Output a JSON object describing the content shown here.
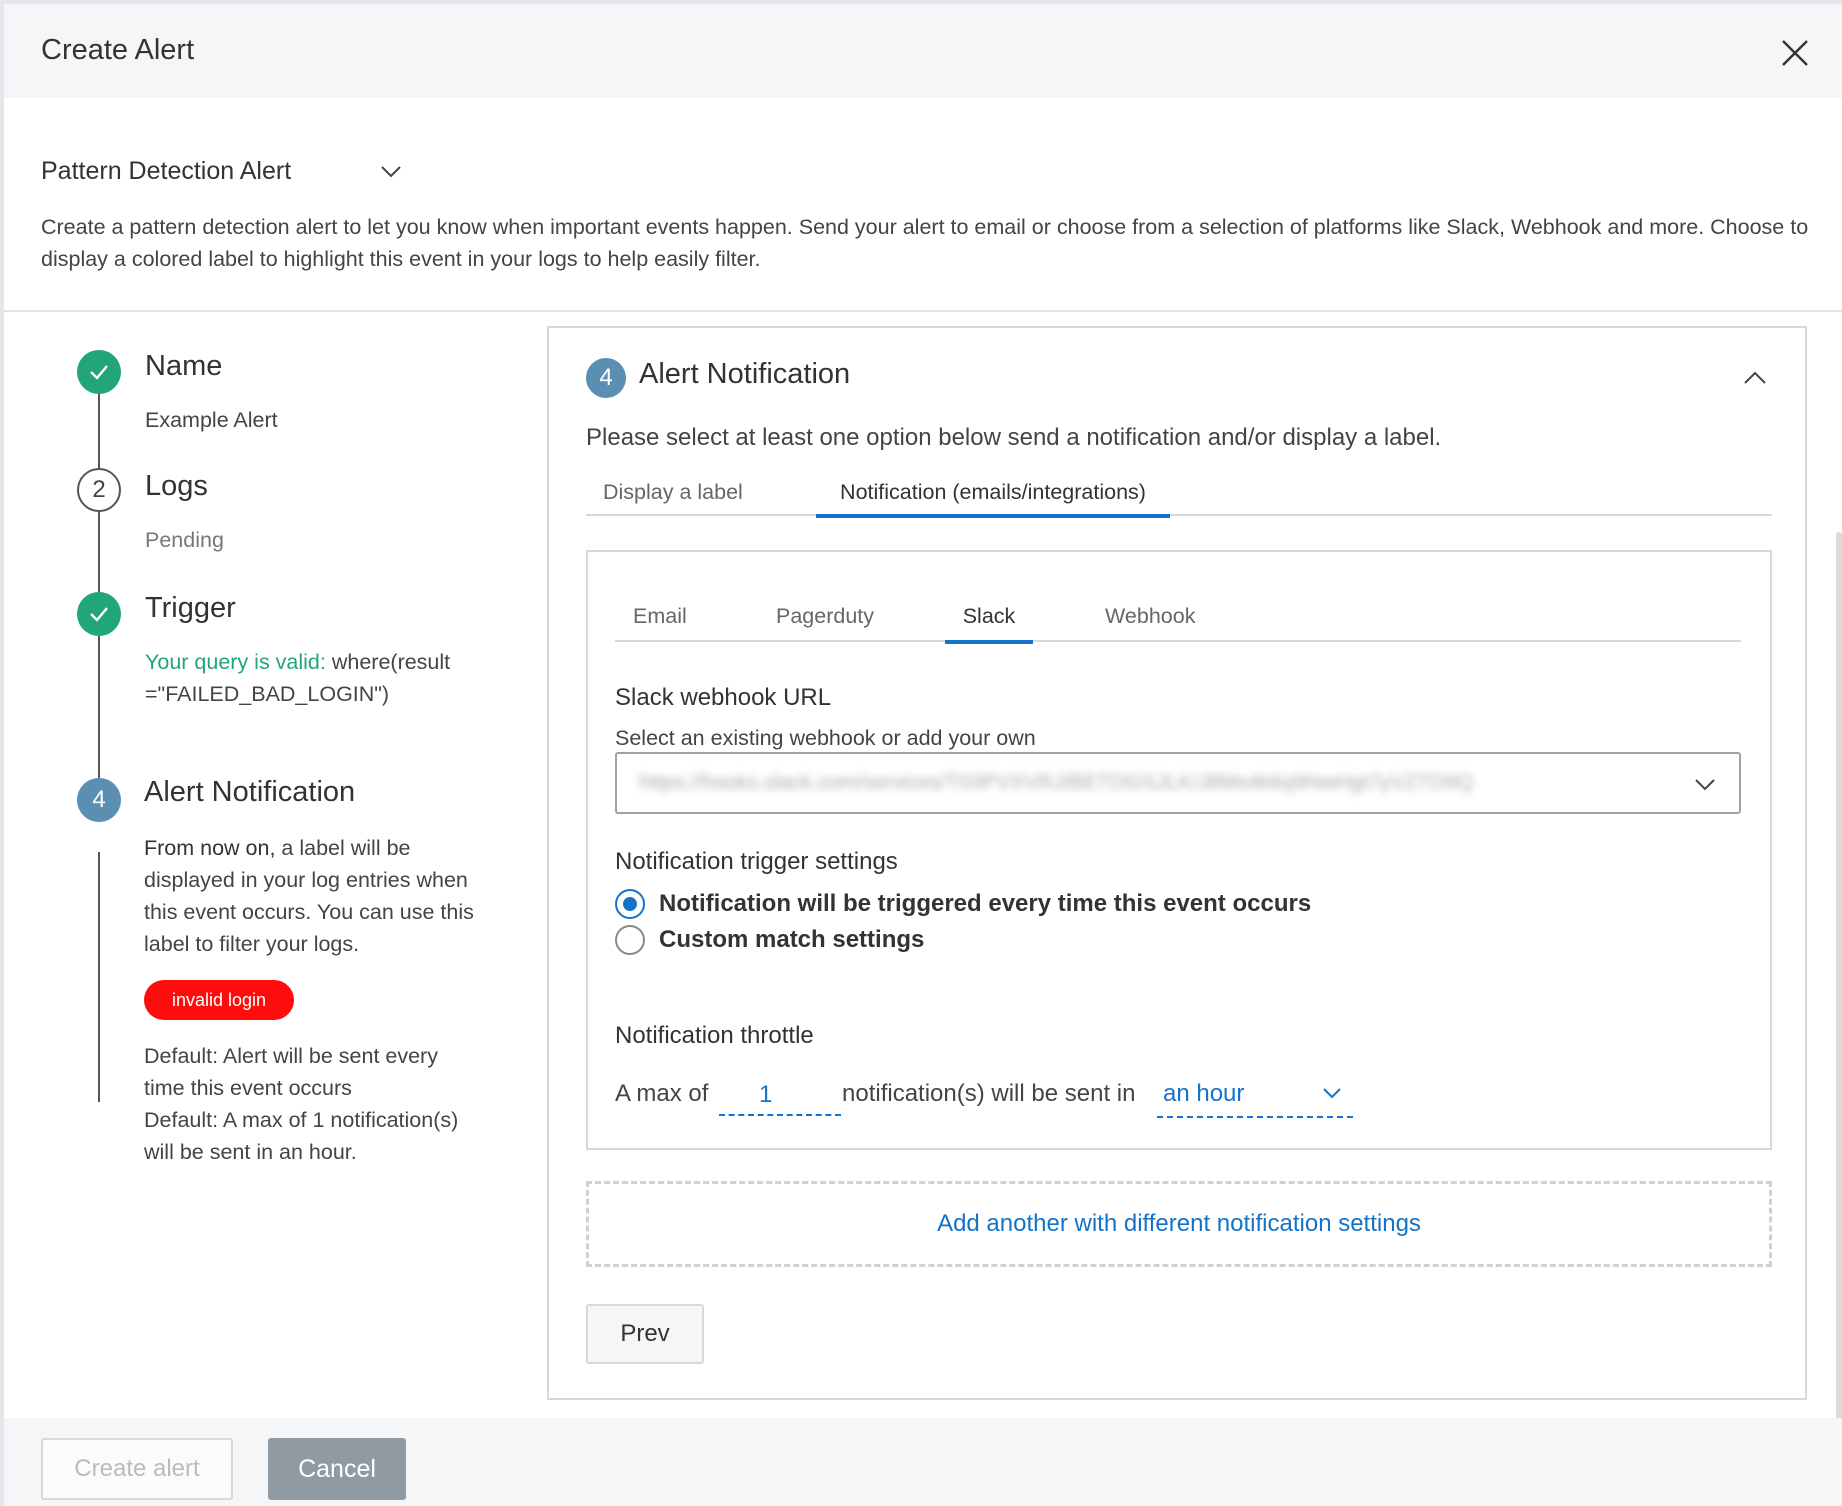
{
  "header": {
    "title": "Create Alert"
  },
  "alert_type": {
    "selected": "Pattern Detection Alert"
  },
  "description": "Create a pattern detection alert to let you know when important events happen. Send your alert to email or choose from a selection of platforms like Slack, Webhook and more. Choose to display a colored label to highlight this event in your logs to help easily filter.",
  "steps": [
    {
      "title": "Name",
      "number": "",
      "status": "done",
      "subtitle": "Example Alert"
    },
    {
      "title": "Logs",
      "number": "2",
      "status": "pending",
      "subtitle": "Pending"
    },
    {
      "title": "Trigger",
      "number": "",
      "status": "done",
      "valid_prefix": "Your query is valid:",
      "query": " where(result=\"FAILED_BAD_LOGIN\")"
    },
    {
      "title": "Alert Notification",
      "number": "4",
      "status": "active",
      "text_bold": "From now on,",
      "text_rest": " a label will be displayed in your log entries when this event occurs. You can use this label to filter your logs.",
      "badge": "invalid login",
      "default_1": "Default: Alert will be sent every time this event occurs",
      "default_2": "Default: A max of 1 notification(s) will be sent in an hour."
    }
  ],
  "panel": {
    "number": "4",
    "title": "Alert Notification",
    "intro": "Please select at least one option below send a notification and/or display a label.",
    "tabs": [
      {
        "label": "Display a label",
        "active": false
      },
      {
        "label": "Notification (emails/integrations)",
        "active": true
      }
    ],
    "sub_tabs": [
      {
        "label": "Email",
        "active": false
      },
      {
        "label": "Pagerduty",
        "active": false
      },
      {
        "label": "Slack",
        "active": true
      },
      {
        "label": "Webhook",
        "active": false
      }
    ],
    "webhook": {
      "label": "Slack webhook URL",
      "hint": "Select an existing webhook or add your own",
      "value": "https://hooks.slack.com/services/T03PVXVRJ/BETDGSJLK/J8Ms4k6q9NwHgt7yVZTD9Q"
    },
    "trigger": {
      "label": "Notification trigger settings",
      "options": [
        {
          "label": "Notification will be triggered every time this event occurs",
          "selected": true
        },
        {
          "label": "Custom match settings",
          "selected": false
        }
      ]
    },
    "throttle": {
      "label": "Notification throttle",
      "prefix": "A max of",
      "count": "1",
      "middle": "notification(s) will be sent in",
      "period": "an hour"
    },
    "add_another": "Add another with different notification settings",
    "prev_label": "Prev"
  },
  "footer": {
    "create_label": "Create alert",
    "cancel_label": "Cancel"
  },
  "colors": {
    "accent": "#1473c8",
    "success": "#22a57a",
    "step_active": "#5a8fb3",
    "badge": "#ff0d0d"
  }
}
